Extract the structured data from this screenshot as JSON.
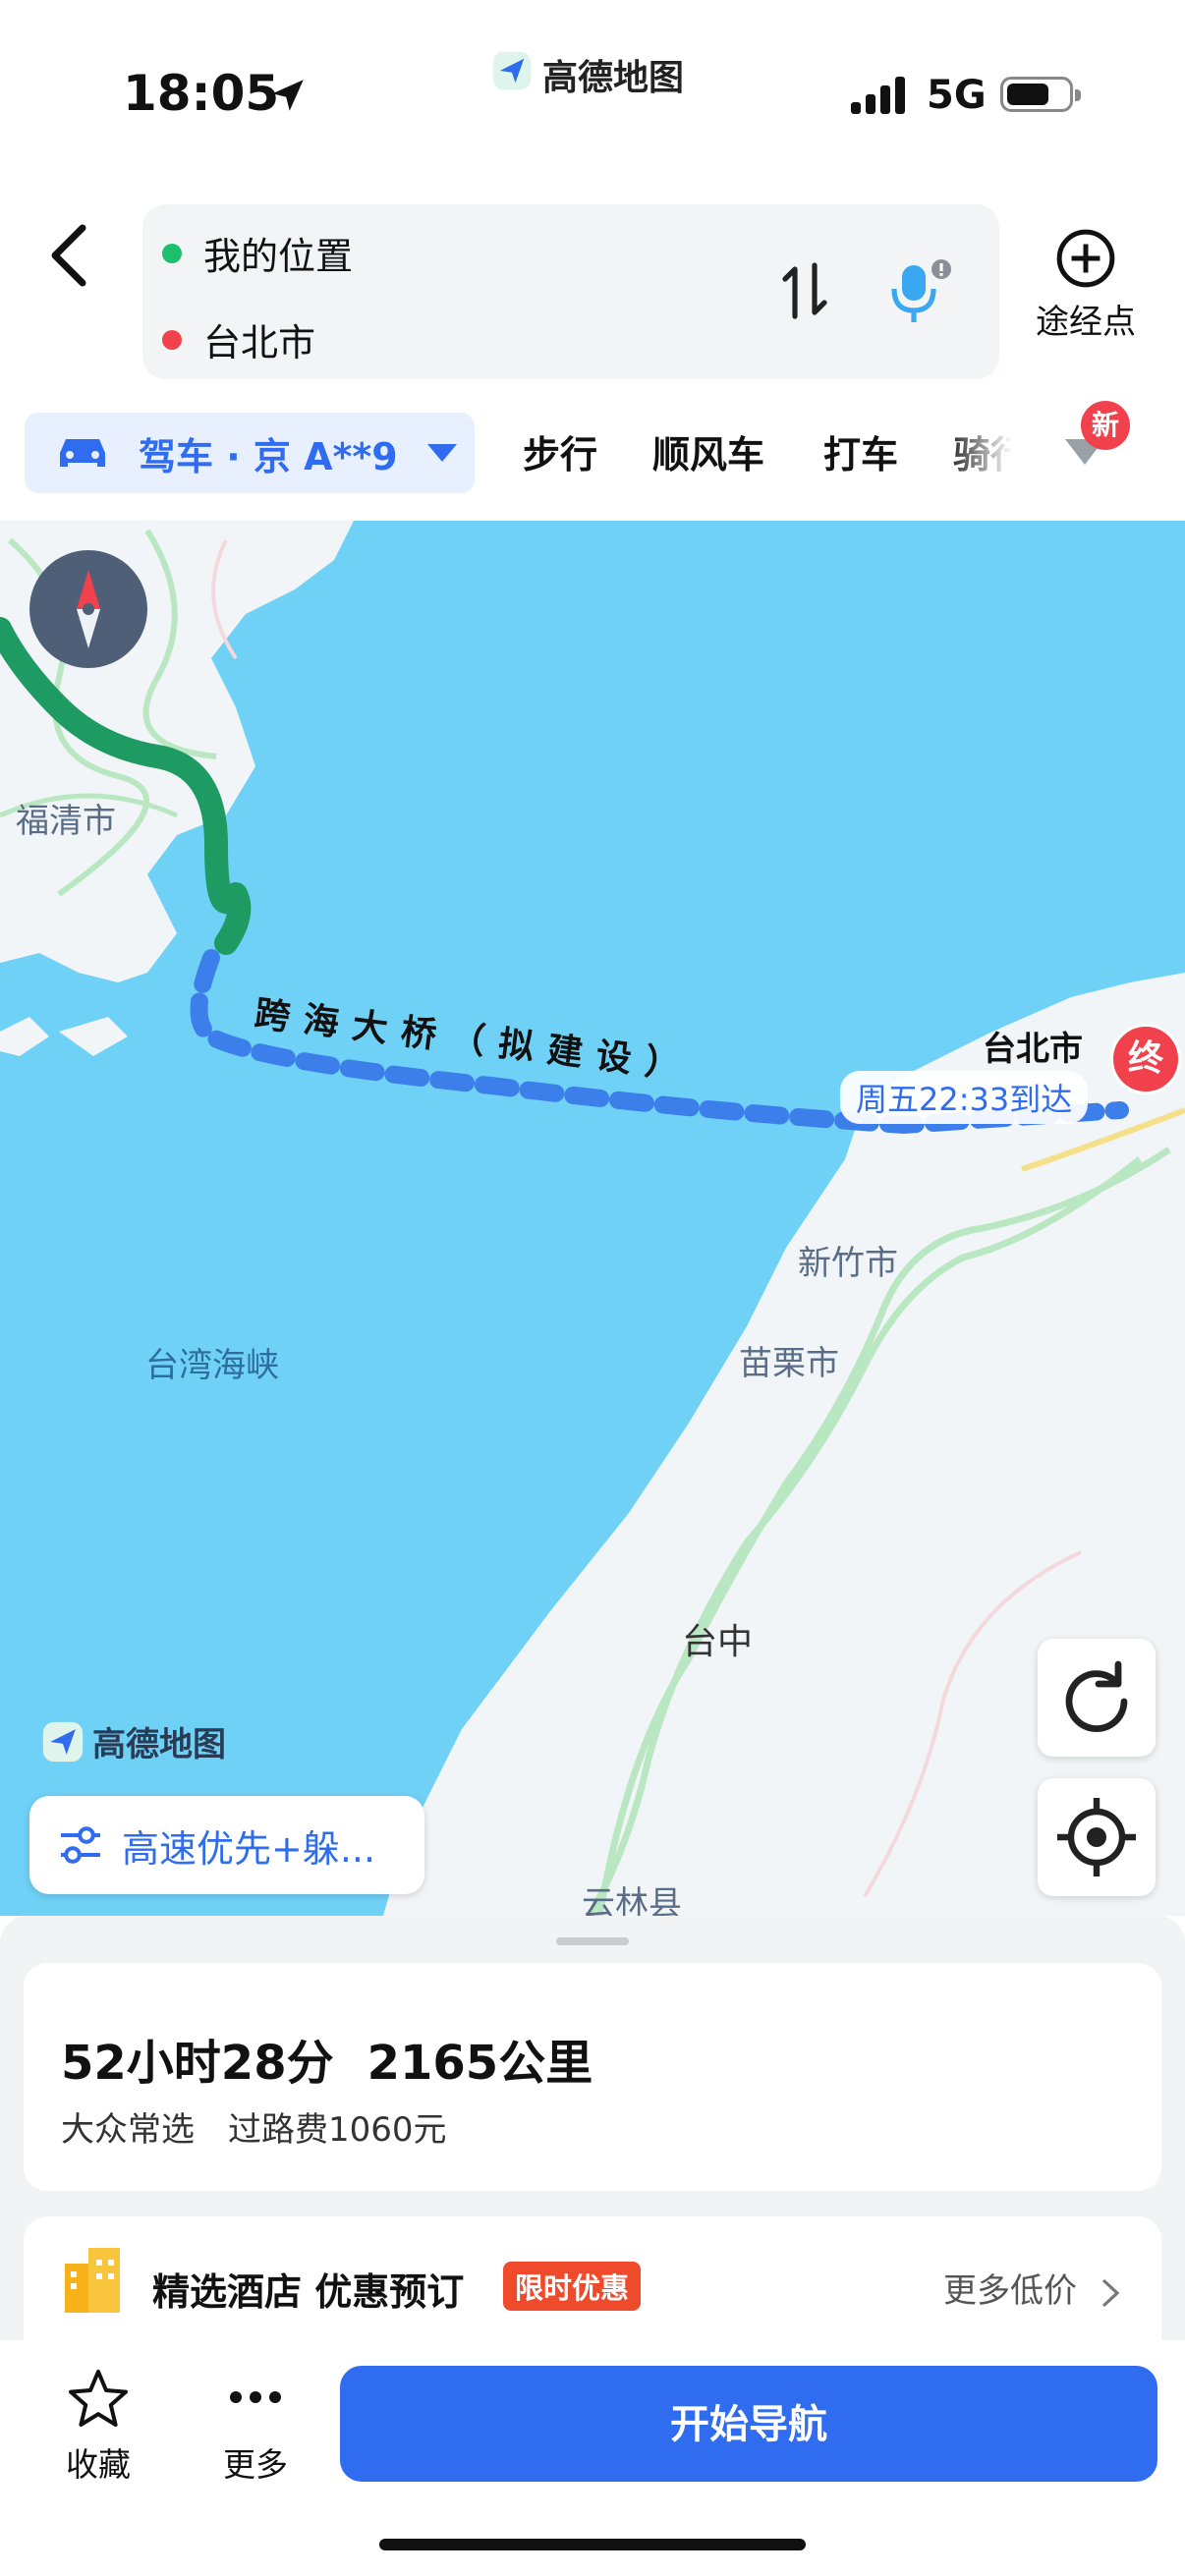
{
  "status_bar": {
    "time": "18:05",
    "app_name": "高德地图",
    "network": "5G"
  },
  "route_input": {
    "origin": "我的位置",
    "destination": "台北市",
    "waypoint_label": "途经点"
  },
  "transport_tabs": {
    "active": "驾车 · 京 A**9",
    "items": [
      "步行",
      "顺风车",
      "打车",
      "骑行"
    ],
    "new_badge": "新"
  },
  "map": {
    "labels": {
      "fuqing": "福清市",
      "bridge": "跨海大桥（拟建设）",
      "taipei": "台北市",
      "arrival": "周五22:33到达",
      "end_marker": "终",
      "hsinchu": "新竹市",
      "miaoli": "苗栗市",
      "strait": "台湾海峡",
      "taichung": "台中",
      "yunlin": "云林县"
    },
    "logo": "高德地图",
    "route_preference": "高速优先+躲..."
  },
  "route_summary": {
    "duration": "52小时28分",
    "distance": "2165公里",
    "tag": "大众常选",
    "toll": "过路费1060元"
  },
  "hotel_promo": {
    "title": "精选酒店 优惠预订",
    "badge": "限时优惠",
    "more": "更多低价"
  },
  "actions": {
    "favorite": "收藏",
    "more": "更多",
    "start_navigation": "开始导航"
  },
  "colors": {
    "accent": "#2f6cf0",
    "route_green": "#1e9a63",
    "origin_dot": "#1dbf6b",
    "destination_dot": "#f0414c",
    "sea": "#6fd1f6"
  }
}
